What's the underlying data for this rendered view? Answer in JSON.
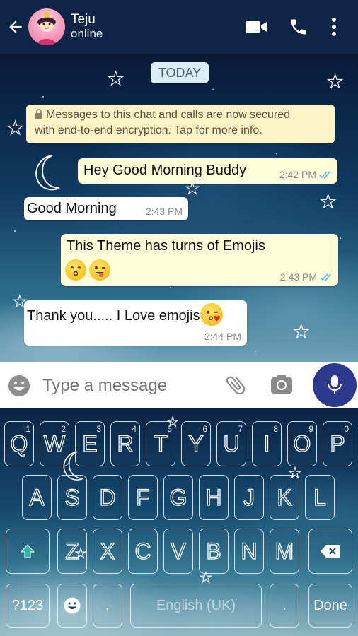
{
  "header": {
    "contact_name": "Teju",
    "contact_status": "online"
  },
  "chat": {
    "date_label": "TODAY",
    "encryption_notice_line1": "Messages to this chat and calls are now secured",
    "encryption_notice_line2": "with end-to-end encryption. Tap for more info.",
    "messages": [
      {
        "direction": "outgoing",
        "text": "Hey Good Morning Buddy",
        "time": "2:42 PM",
        "read": true
      },
      {
        "direction": "incoming",
        "text": "Good Morning",
        "time": "2:43 PM"
      },
      {
        "direction": "outgoing",
        "text": "This Theme has turns of Emojis",
        "time": "2:43 PM",
        "read": true,
        "emojis": [
          "kissing-face",
          "winking-tongue-face"
        ]
      },
      {
        "direction": "incoming",
        "text": "Thank you..... I Love emojis",
        "time": "2:44 PM",
        "emojis": [
          "kissing-heart-face"
        ]
      }
    ]
  },
  "input": {
    "placeholder": "Type a message"
  },
  "keyboard": {
    "row1": [
      "Q",
      "W",
      "E",
      "R",
      "T",
      "Y",
      "U",
      "I",
      "O",
      "P"
    ],
    "row1_hints": [
      "1",
      "2",
      "3",
      "4",
      "5",
      "6",
      "7",
      "8",
      "9",
      "0"
    ],
    "row2": [
      "A",
      "S",
      "D",
      "F",
      "G",
      "H",
      "J",
      "K",
      "L"
    ],
    "row3": [
      "Z",
      "X",
      "C",
      "V",
      "B",
      "N",
      "M"
    ],
    "symbols_key": "?123",
    "comma_key": ",",
    "space_label": "English (UK)",
    "period_key": ".",
    "done_key": "Done"
  },
  "colors": {
    "header_bg": "#0f2548",
    "outgoing_bubble": "#fefed8",
    "incoming_bubble": "#ffffff",
    "notice_bg": "#fdf4c5",
    "mic_button": "#2b3a8f",
    "read_tick": "#4fb6ec"
  }
}
